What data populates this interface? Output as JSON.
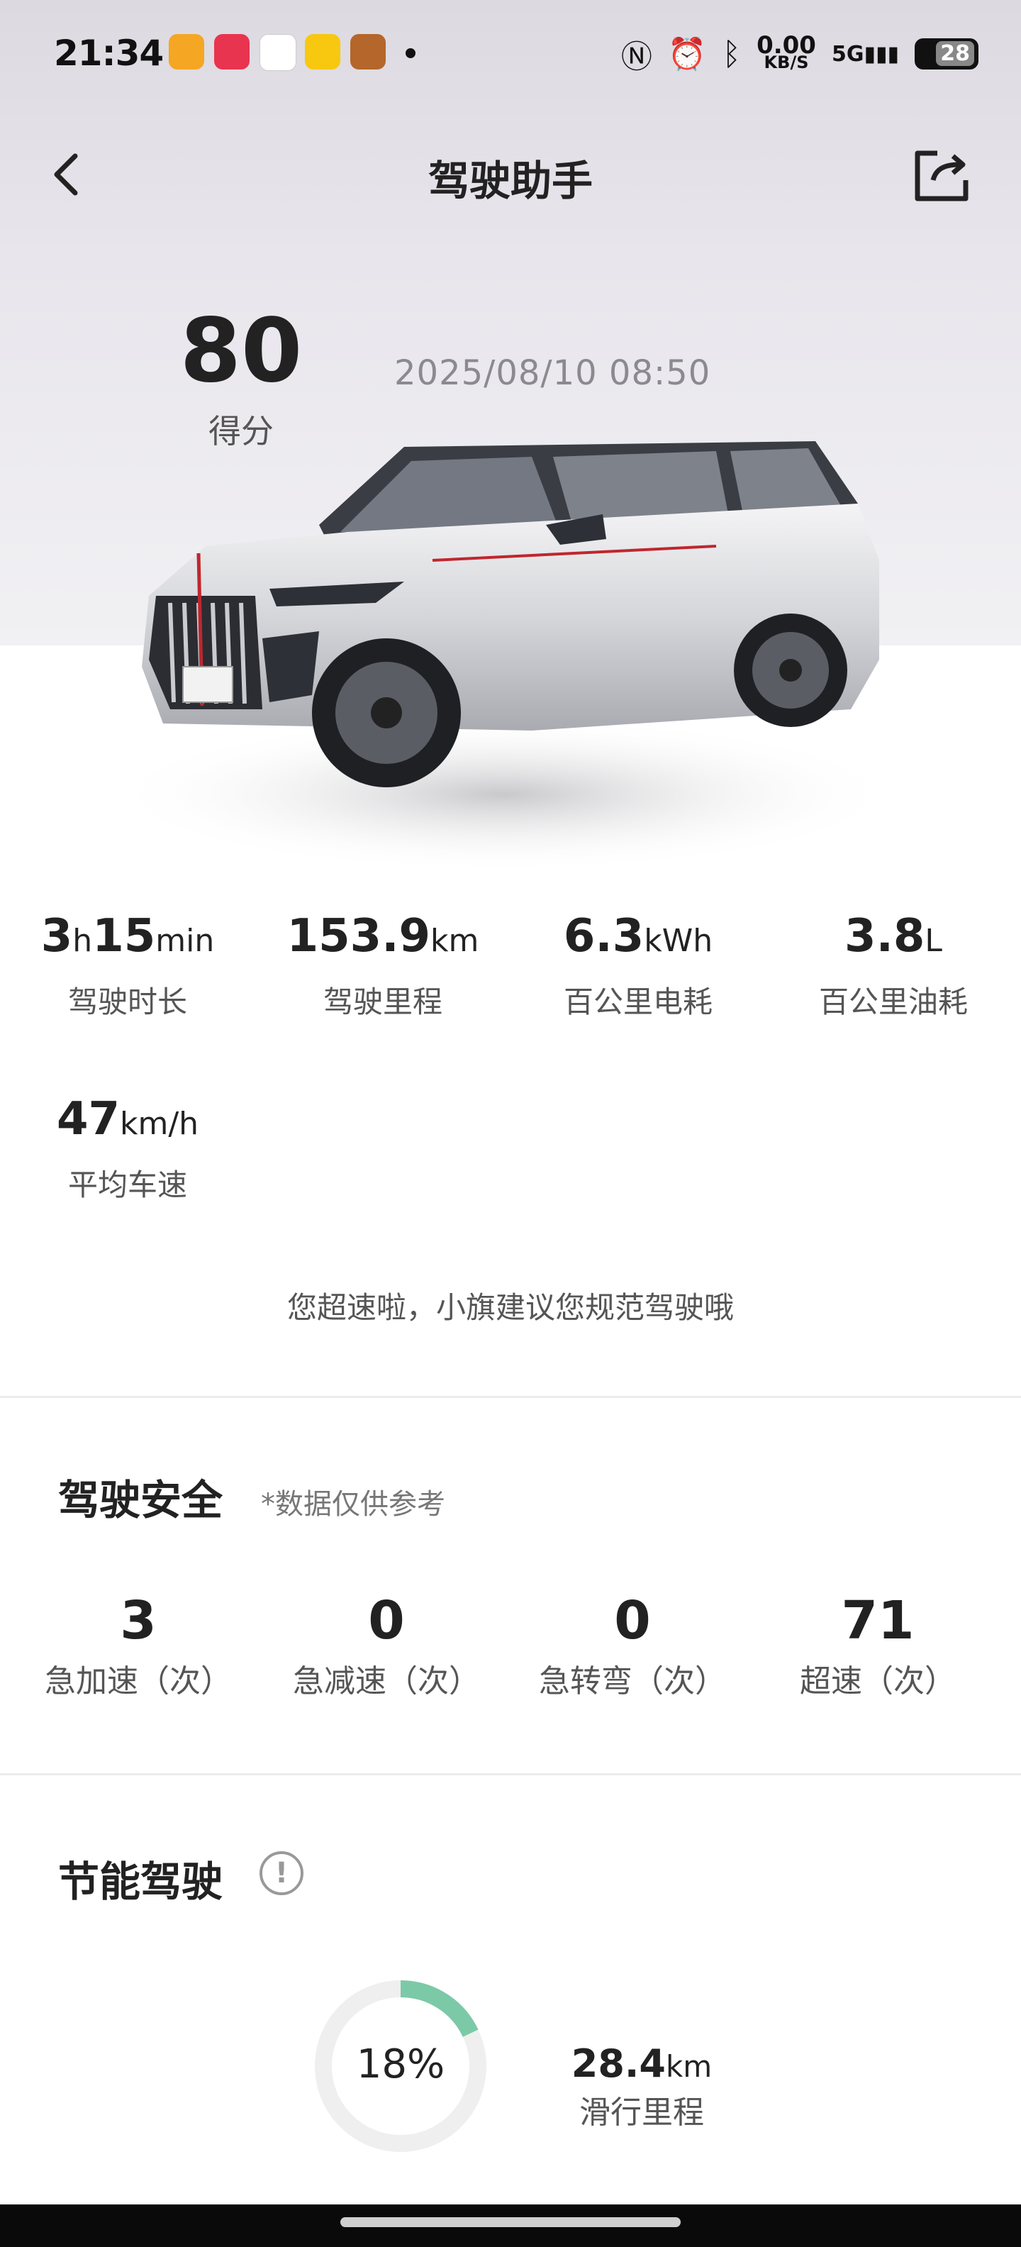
{
  "status_bar": {
    "time": "21:34",
    "net_speed_value": "0.00",
    "net_speed_unit": "KB/S",
    "network": "5G",
    "battery": "28"
  },
  "header": {
    "title": "驾驶助手"
  },
  "score": {
    "value": "80",
    "label": "得分",
    "datetime": "2025/08/10  08:50"
  },
  "stats": [
    {
      "value_parts": [
        "3",
        "h",
        "15",
        "min"
      ],
      "label": "驾驶时长"
    },
    {
      "value": "153.9",
      "unit": "km",
      "label": "驾驶里程"
    },
    {
      "value": "6.3",
      "unit": "kWh",
      "label": "百公里电耗"
    },
    {
      "value": "3.8",
      "unit": "L",
      "label": "百公里油耗"
    },
    {
      "value": "47",
      "unit": "km/h",
      "label": "平均车速"
    }
  ],
  "tip": "您超速啦，小旗建议您规范驾驶哦",
  "safety": {
    "title": "驾驶安全",
    "note": "*数据仅供参考",
    "items": [
      {
        "count": "3",
        "label": "急加速（次）"
      },
      {
        "count": "0",
        "label": "急减速（次）"
      },
      {
        "count": "0",
        "label": "急转弯（次）"
      },
      {
        "count": "71",
        "label": "超速（次）"
      }
    ]
  },
  "eco": {
    "title": "节能驾驶",
    "info_icon": "!",
    "coast_percent": 18,
    "coast_percent_label": "18%",
    "coast_distance": "28.4",
    "coast_unit": "km",
    "coast_label": "滑行里程",
    "accent_color": "#7cc9a8"
  }
}
